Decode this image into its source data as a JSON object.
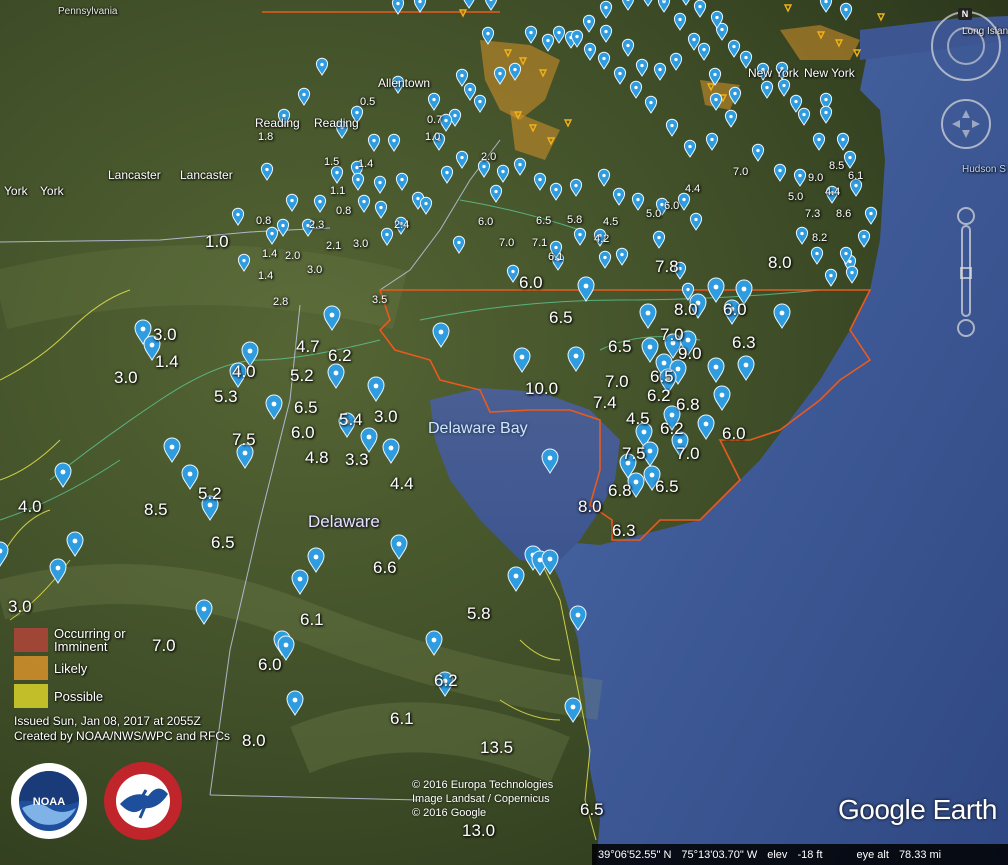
{
  "app": {
    "name": "Google Earth"
  },
  "places": [
    {
      "id": "pennsylvania",
      "text": "Pennsylvania"
    },
    {
      "id": "allentown",
      "text": "Allentown"
    },
    {
      "id": "reading1",
      "text": "Reading"
    },
    {
      "id": "reading2",
      "text": "Reading"
    },
    {
      "id": "lancaster1",
      "text": "Lancaster"
    },
    {
      "id": "lancaster2",
      "text": "Lancaster"
    },
    {
      "id": "york1",
      "text": "York"
    },
    {
      "id": "york2",
      "text": "York"
    },
    {
      "id": "newyork1",
      "text": "New York"
    },
    {
      "id": "newyork2",
      "text": "New York"
    },
    {
      "id": "longisland",
      "text": "Long Island"
    },
    {
      "id": "hudson",
      "text": "Hudson S"
    },
    {
      "id": "delawarebay",
      "text": "Delaware Bay"
    },
    {
      "id": "delaware",
      "text": "Delaware"
    }
  ],
  "snowfall_values": [
    "3.0",
    "1.4",
    "3.0",
    "4.7",
    "6.2",
    "4.0",
    "5.2",
    "5.3",
    "6.5",
    "5.4",
    "3.0",
    "7.5",
    "6.0",
    "4.8",
    "3.3",
    "4.4",
    "4.0",
    "8.5",
    "5.2",
    "6.5",
    "6.6",
    "3.0",
    "7.0",
    "6.1",
    "6.0",
    "5.8",
    "6.2",
    "8.0",
    "6.1",
    "13.5",
    "13.0",
    "6.5",
    "10.0",
    "7.4",
    "7.0",
    "4.5",
    "6.2",
    "6.8",
    "6.2",
    "7.5",
    "7.0",
    "6.8",
    "6.5",
    "8.0",
    "6.3",
    "6.0",
    "6.5",
    "7.0",
    "9.0",
    "6.3",
    "8.0",
    "6.0",
    "6.5",
    "6.5",
    "6.0",
    "7.8",
    "8.0",
    "1.0",
    "0.8",
    "1.4",
    "2.0",
    "3.0",
    "1.4",
    "2.8",
    "3.5",
    "2.3",
    "2.1",
    "3.0",
    "2.4",
    "1.1",
    "0.8",
    "1.5",
    "1.4",
    "1.8",
    "0.5",
    "1.0",
    "0.7",
    "2.0",
    "6.0",
    "7.0",
    "7.1",
    "6.1",
    "4.2",
    "6.5",
    "5.8",
    "4.5",
    "5.0",
    "6.0",
    "4.4",
    "7.0",
    "5.0",
    "7.3",
    "8.2",
    "8.6",
    "9.0",
    "8.5",
    "6.1",
    "4.4",
    "6.5",
    "5.0"
  ],
  "legend": {
    "items": [
      {
        "label": "Occurring or Imminent",
        "color": "#b0443a"
      },
      {
        "label": "Likely",
        "color": "#d6922a"
      },
      {
        "label": "Possible",
        "color": "#d8d22c"
      }
    ]
  },
  "issued": {
    "line1": "Issued Sun, Jan 08, 2017 at 2055Z",
    "line2": "Created by NOAA/NWS/WPC and RFCs"
  },
  "logos": {
    "noaa": "NOAA",
    "nws_text": "NATIONAL WEATHER SERVICE"
  },
  "credits": {
    "line1": "© 2016 Europa Technologies",
    "line2": "Image Landsat / Copernicus",
    "line3": "© 2016 Google"
  },
  "ge_logo": "Google Earth",
  "status": {
    "lat": "39°06'52.55\" N",
    "lon": "75°13'03.70\" W",
    "elev_label": "elev",
    "elev": "-18 ft",
    "eye_label": "eye alt",
    "eye": "78.33 mi"
  },
  "nav": {
    "north": "N"
  },
  "colors": {
    "ocean": "#3a5591",
    "land": "#3f4f2a",
    "pin": "#2f9ce0",
    "boundary": "#e85a1e",
    "county": "#e4e44a"
  }
}
